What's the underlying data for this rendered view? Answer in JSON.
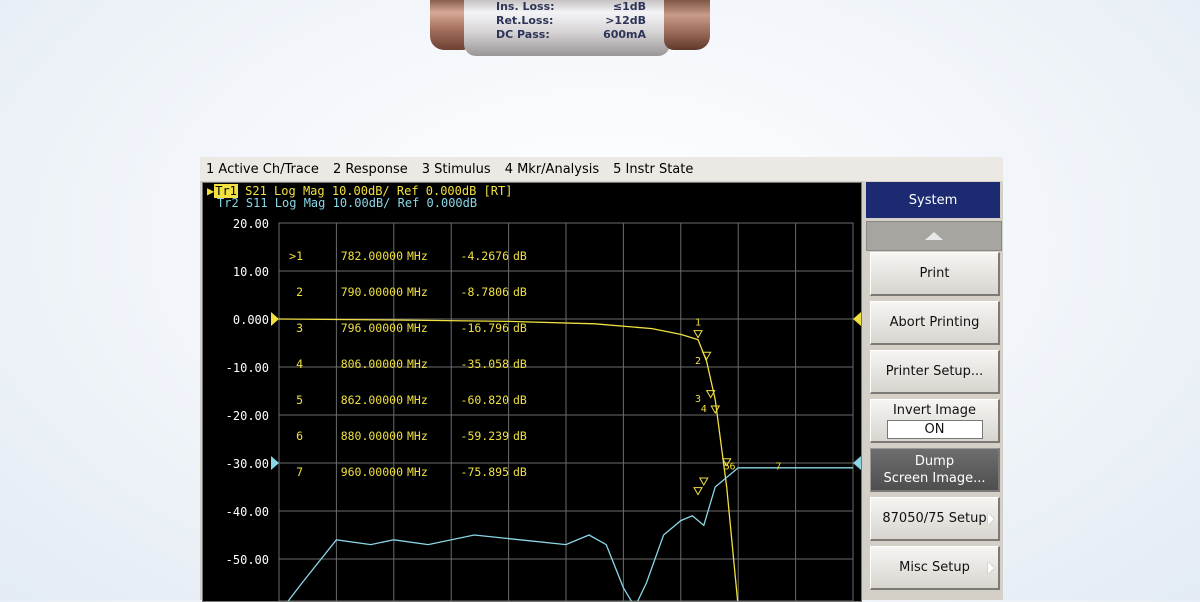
{
  "photo": {
    "label_rows": [
      {
        "name": "Ins. Loss:",
        "value": "≤1dB"
      },
      {
        "name": "Ret.Loss:",
        "value": ">12dB"
      },
      {
        "name": "DC Pass:",
        "value": "600mA"
      }
    ]
  },
  "menubar": {
    "items": [
      {
        "label": "1 Active Ch/Trace"
      },
      {
        "label": "2 Response"
      },
      {
        "label": "3 Stimulus"
      },
      {
        "label": "4 Mkr/Analysis"
      },
      {
        "label": "5 Instr State"
      }
    ]
  },
  "screen": {
    "trace1_badge": "Tr1",
    "trace1_header": " S21 Log Mag 10.00dB/ Ref 0.000dB [RT]",
    "trace2_header": "Tr2 S11 Log Mag 10.00dB/ Ref 0.000dB",
    "markers": [
      {
        "id": ">1",
        "freq": "782.00000",
        "unit": "MHz",
        "value": "-4.2676",
        "db": "dB"
      },
      {
        "id": "2",
        "freq": "790.00000",
        "unit": "MHz",
        "value": "-8.7806",
        "db": "dB"
      },
      {
        "id": "3",
        "freq": "796.00000",
        "unit": "MHz",
        "value": "-16.796",
        "db": "dB"
      },
      {
        "id": "4",
        "freq": "806.00000",
        "unit": "MHz",
        "value": "-35.058",
        "db": "dB"
      },
      {
        "id": "5",
        "freq": "862.00000",
        "unit": "MHz",
        "value": "-60.820",
        "db": "dB"
      },
      {
        "id": "6",
        "freq": "880.00000",
        "unit": "MHz",
        "value": "-59.239",
        "db": "dB"
      },
      {
        "id": "7",
        "freq": "960.00000",
        "unit": "MHz",
        "value": "-75.895",
        "db": "dB"
      }
    ],
    "y_ticks": [
      "20.00",
      "10.00",
      "0.000",
      "-10.00",
      "-20.00",
      "-30.00",
      "-40.00",
      "-50.00"
    ],
    "colors": {
      "trace1": "#f0e040",
      "trace2": "#8ad6e6",
      "grid": "#6b6b6b"
    }
  },
  "chart_data": {
    "type": "line",
    "y_ticks": [
      20,
      10,
      0,
      -10,
      -20,
      -30,
      -40,
      -50
    ],
    "y_divisions_per_10dB": 1,
    "series": [
      {
        "name": "Tr1",
        "color": "#f0e040",
        "points": [
          [
            0,
            0
          ],
          [
            0.2,
            -0.2
          ],
          [
            0.4,
            -0.5
          ],
          [
            0.55,
            -1
          ],
          [
            0.65,
            -2
          ],
          [
            0.7,
            -3.2
          ],
          [
            0.73,
            -4.3
          ],
          [
            0.745,
            -8.8
          ],
          [
            0.76,
            -16.8
          ],
          [
            0.78,
            -35
          ],
          [
            0.8,
            -60
          ],
          [
            0.82,
            -75
          ],
          [
            0.86,
            -75.9
          ],
          [
            0.9,
            -72
          ],
          [
            0.94,
            -66
          ],
          [
            0.97,
            -64
          ],
          [
            1,
            -63
          ]
        ]
      },
      {
        "name": "Tr2",
        "color": "#8ad6e6",
        "points": [
          [
            0,
            -62
          ],
          [
            0.04,
            -55
          ],
          [
            0.1,
            -46
          ],
          [
            0.16,
            -47
          ],
          [
            0.2,
            -46
          ],
          [
            0.26,
            -47
          ],
          [
            0.34,
            -45
          ],
          [
            0.42,
            -46
          ],
          [
            0.5,
            -47
          ],
          [
            0.54,
            -45
          ],
          [
            0.57,
            -47
          ],
          [
            0.6,
            -56
          ],
          [
            0.62,
            -60
          ],
          [
            0.64,
            -55
          ],
          [
            0.67,
            -45
          ],
          [
            0.7,
            -42
          ],
          [
            0.72,
            -41
          ],
          [
            0.74,
            -43
          ],
          [
            0.76,
            -35
          ],
          [
            0.8,
            -31
          ],
          [
            1,
            -31
          ]
        ]
      }
    ],
    "marker_ids": [
      "1",
      "2",
      "3",
      "4",
      "5",
      "6",
      "7"
    ]
  },
  "panel": {
    "title": "System",
    "buttons": [
      {
        "label": "Print"
      },
      {
        "label": "Abort Printing"
      },
      {
        "label": "Printer Setup..."
      },
      {
        "label": "Invert Image",
        "state": "ON"
      },
      {
        "label": "Dump",
        "label2": "Screen Image..."
      },
      {
        "label": "87050/75 Setup"
      },
      {
        "label": "Misc Setup"
      }
    ]
  }
}
